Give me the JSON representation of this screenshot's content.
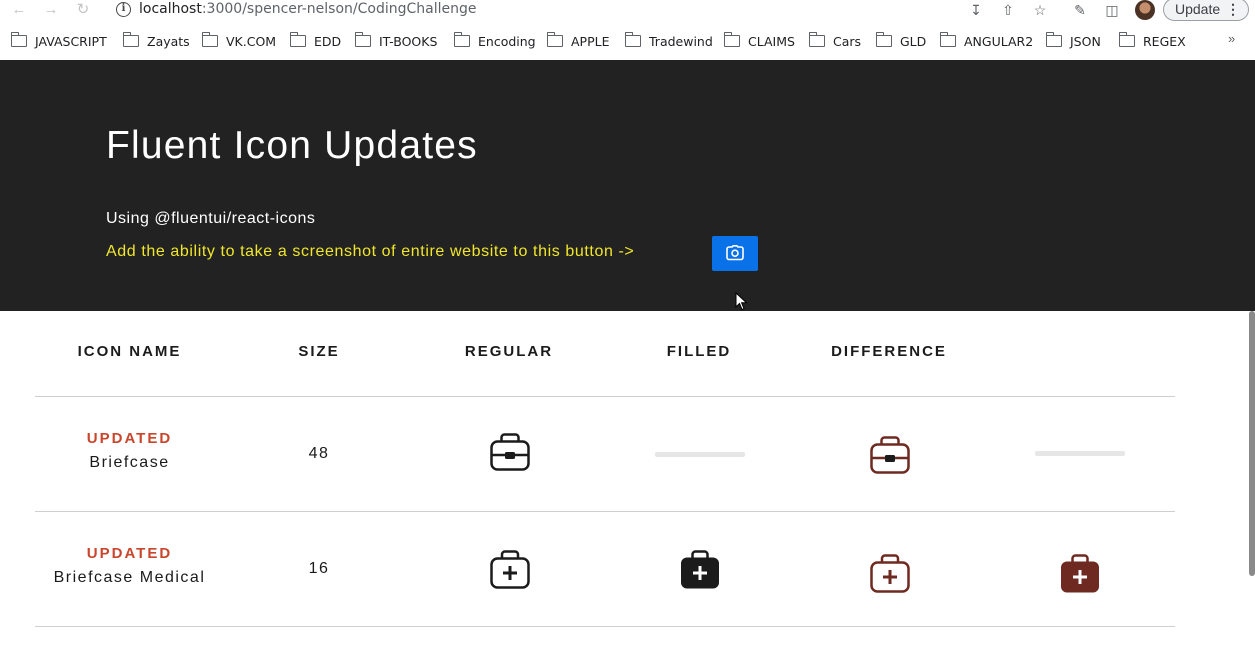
{
  "browser": {
    "url_host": "localhost",
    "url_path": ":3000/spencer-nelson/CodingChallenge",
    "update_label": "Update",
    "bookmarks": [
      "JAVASCRIPT",
      "Zayats",
      "VK.COM",
      "EDD",
      "IT-BOOKS",
      "Encoding",
      "APPLE",
      "Tradewind",
      "CLAIMS",
      "Cars",
      "GLD",
      "ANGULAR2",
      "JSON",
      "REGEX"
    ],
    "more_label": "»"
  },
  "hero": {
    "title": "Fluent Icon Updates",
    "subtitle": "Using @fluentui/react-icons",
    "note": "Add the ability to take a screenshot of entire website to this button ->",
    "button_icon": "camera-icon"
  },
  "table": {
    "headers": [
      "ICON NAME",
      "SIZE",
      "REGULAR",
      "FILLED",
      "DIFFERENCE"
    ],
    "rows": [
      {
        "status": "UPDATED",
        "name": "Briefcase",
        "size": "48",
        "regular_icon": "briefcase-icon",
        "filled_icon": "",
        "difference_regular_icon": "briefcase-icon",
        "difference_filled_icon": ""
      },
      {
        "status": "UPDATED",
        "name": "Briefcase Medical",
        "size": "16",
        "regular_icon": "briefcase-medical-icon",
        "filled_icon": "briefcase-medical-filled-icon",
        "difference_regular_icon": "briefcase-medical-icon",
        "difference_filled_icon": "briefcase-medical-filled-icon"
      }
    ]
  },
  "colors": {
    "hero_bg": "#222222",
    "note_yellow": "#f0e62a",
    "button_blue": "#0a72e8",
    "status_orange": "#c9452b",
    "difference_brown": "#6e2a20"
  }
}
